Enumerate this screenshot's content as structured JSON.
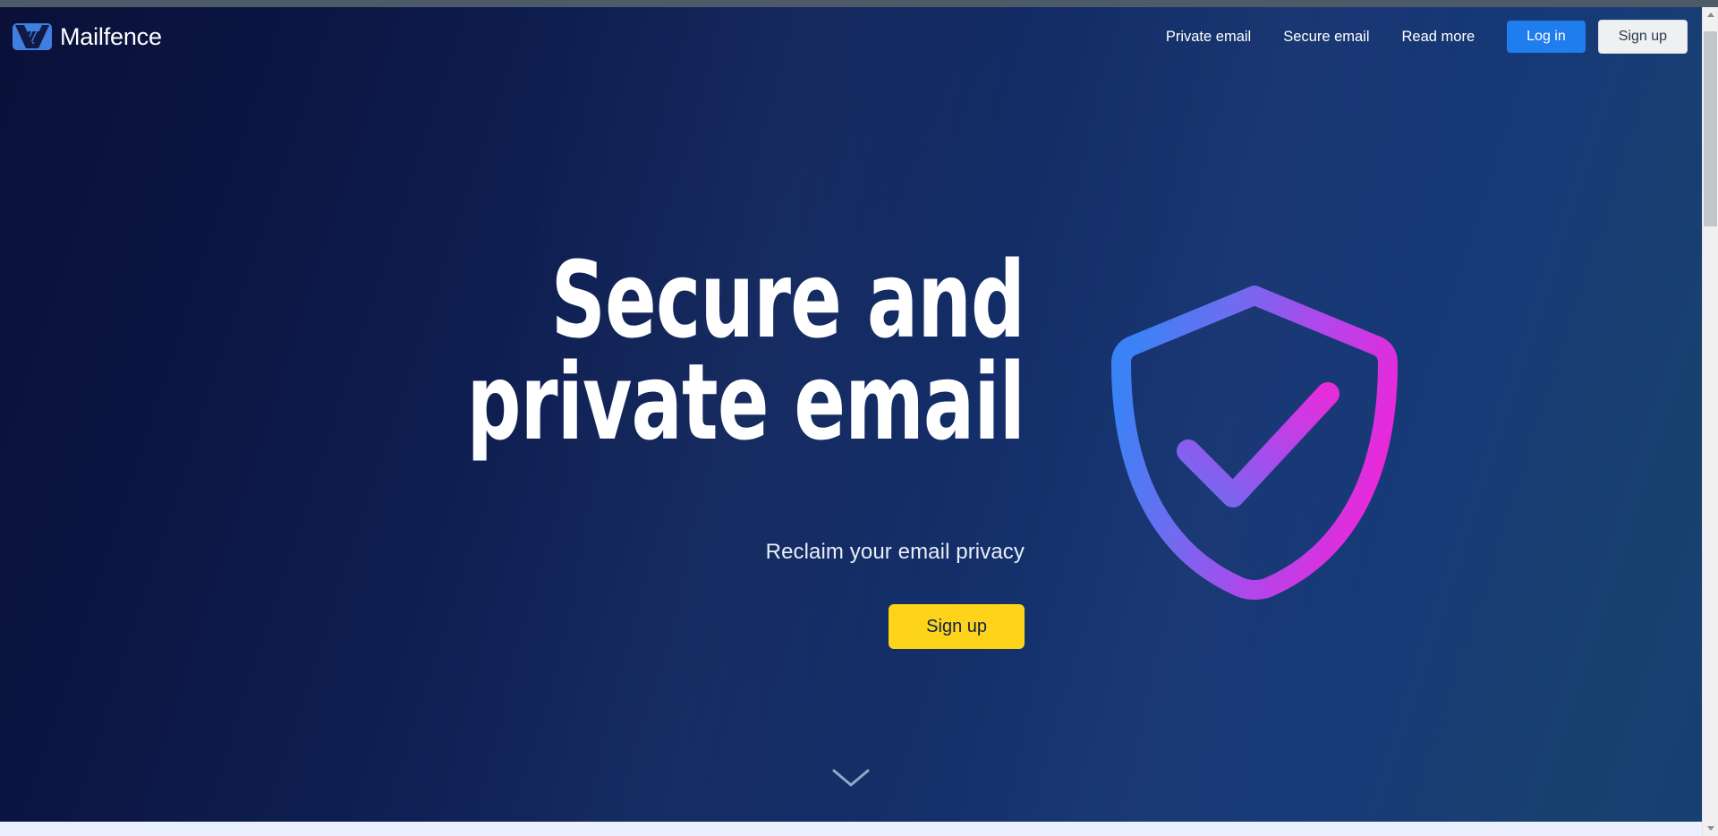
{
  "window": {
    "chrome_color": "#4d5a68"
  },
  "brand": {
    "name": "Mailfence",
    "mark_icon": "mailfence-logo-icon",
    "mark_color": "#3f7fe0"
  },
  "nav": {
    "links": [
      {
        "label": "Private email"
      },
      {
        "label": "Secure email"
      },
      {
        "label": "Read more"
      }
    ],
    "login_label": "Log in",
    "signup_label": "Sign up",
    "login_color": "#1f7ded",
    "signup_color": "#eef0f2"
  },
  "hero": {
    "title": "Secure and private email",
    "subtitle": "Reclaim your email privacy",
    "cta_label": "Sign up",
    "cta_color": "#fdd419",
    "cta_text_color": "#10204a",
    "background_from": "#0a1038",
    "background_to": "#174070",
    "illustration_icon": "shield-check-icon",
    "illustration_gradient_from": "#3b82f6",
    "illustration_gradient_to": "#ef25d8",
    "scroll_icon": "chevron-down-icon"
  },
  "next_section": {
    "background": "#eaf0fd"
  },
  "scrollbar": {
    "up_icon": "scroll-up-arrow-icon",
    "down_icon": "scroll-down-arrow-icon",
    "thumb_color": "#c3c6ca",
    "track_color": "#f0f0f0"
  }
}
